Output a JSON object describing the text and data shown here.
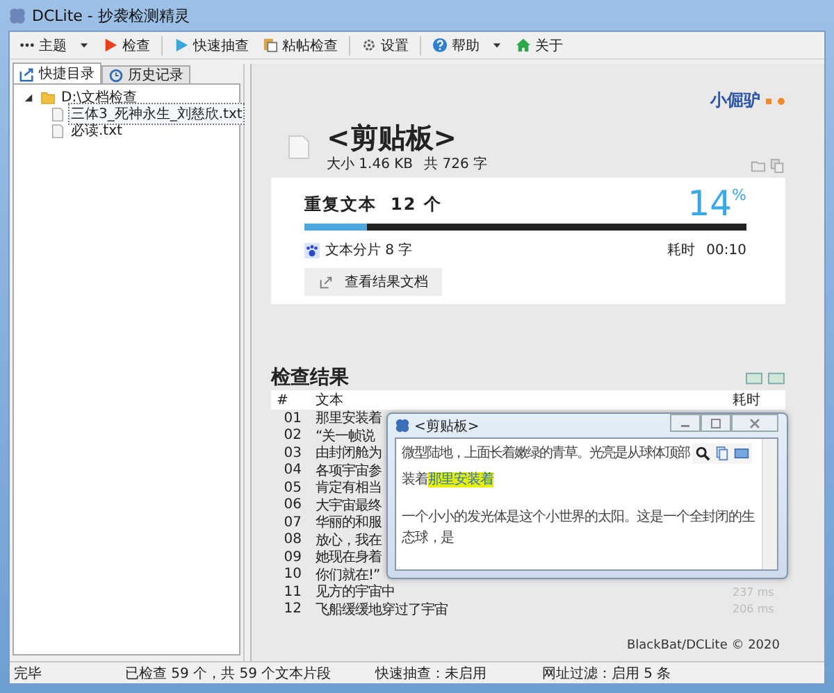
{
  "window": {
    "title": "DCLite - 抄袭检测精灵"
  },
  "toolbar": [
    {
      "kind": "dots",
      "label": "主题",
      "caret": true
    },
    {
      "kind": "red-play",
      "label": "检查",
      "caret": false
    },
    {
      "kind": "sep"
    },
    {
      "kind": "blue-play",
      "label": "快速抽查",
      "caret": false
    },
    {
      "kind": "paste",
      "label": "粘帖检查",
      "caret": false
    },
    {
      "kind": "sep"
    },
    {
      "kind": "gear",
      "label": "设置",
      "caret": false
    },
    {
      "kind": "sep"
    },
    {
      "kind": "help",
      "label": "帮助",
      "caret": true
    },
    {
      "kind": "home",
      "label": "关于",
      "caret": false
    }
  ],
  "tabs": [
    {
      "label": "快捷目录",
      "selected": true
    },
    {
      "label": "历史记录",
      "selected": false
    }
  ],
  "tree": [
    {
      "label": "D:\\文档检查",
      "kind": "folder",
      "expanded": true,
      "selected": false,
      "children": [
        {
          "label": "三体3_死神永生_刘慈欣.txt",
          "kind": "file",
          "selected": true
        },
        {
          "label": "必读.txt",
          "kind": "file",
          "selected": false
        }
      ]
    }
  ],
  "brand": "小倔驴",
  "document": {
    "title": "<剪贴板>",
    "size": "大小 1.46 KB",
    "count": "共 726 字"
  },
  "summary": {
    "label": "重复文本",
    "count": "12 个",
    "percent": "14",
    "percent_sign": "%",
    "level": 0.14,
    "fragment": "文本分片 8 字",
    "time_label": "耗时",
    "time": "00:10",
    "button": "查看结果文档"
  },
  "results": {
    "title": "检查结果",
    "columns": [
      "#",
      "文本",
      "耗时"
    ],
    "rows": [
      {
        "n": "01",
        "text": "那里安装着"
      },
      {
        "n": "02",
        "text": "“关一帧说"
      },
      {
        "n": "03",
        "text": "由封闭舱为"
      },
      {
        "n": "04",
        "text": "各项宇宙参"
      },
      {
        "n": "05",
        "text": "肯定有相当"
      },
      {
        "n": "06",
        "text": "大宇宙最终"
      },
      {
        "n": "07",
        "text": "华丽的和服"
      },
      {
        "n": "08",
        "text": "放心，我在"
      },
      {
        "n": "09",
        "text": "她现在身着"
      },
      {
        "n": "10",
        "text": "你们就在!”"
      },
      {
        "n": "11",
        "text": "见方的宇宙中",
        "time": "237 ms"
      },
      {
        "n": "12",
        "text": "飞船缓缓地穿过了宇宙",
        "time": "206 ms"
      }
    ]
  },
  "popup": {
    "title": "<剪贴板>",
    "paragraphs": [
      {
        "text": "微型陆地，上面长着嫩绿的青草。光亮是从球体顶部"
      },
      {
        "text": "装着",
        "highlight": "那里安装着"
      },
      {
        "text": "一个小小的发光体是这个小世界的太阳。这是一个全封闭的生态球，是"
      }
    ]
  },
  "footer": "BlackBat/DCLite © 2020",
  "status_bar": [
    "完毕",
    "已检查 59 个，共 59 个文本片段",
    "快速抽查：未启用",
    "网址过滤：启用 5 条"
  ]
}
